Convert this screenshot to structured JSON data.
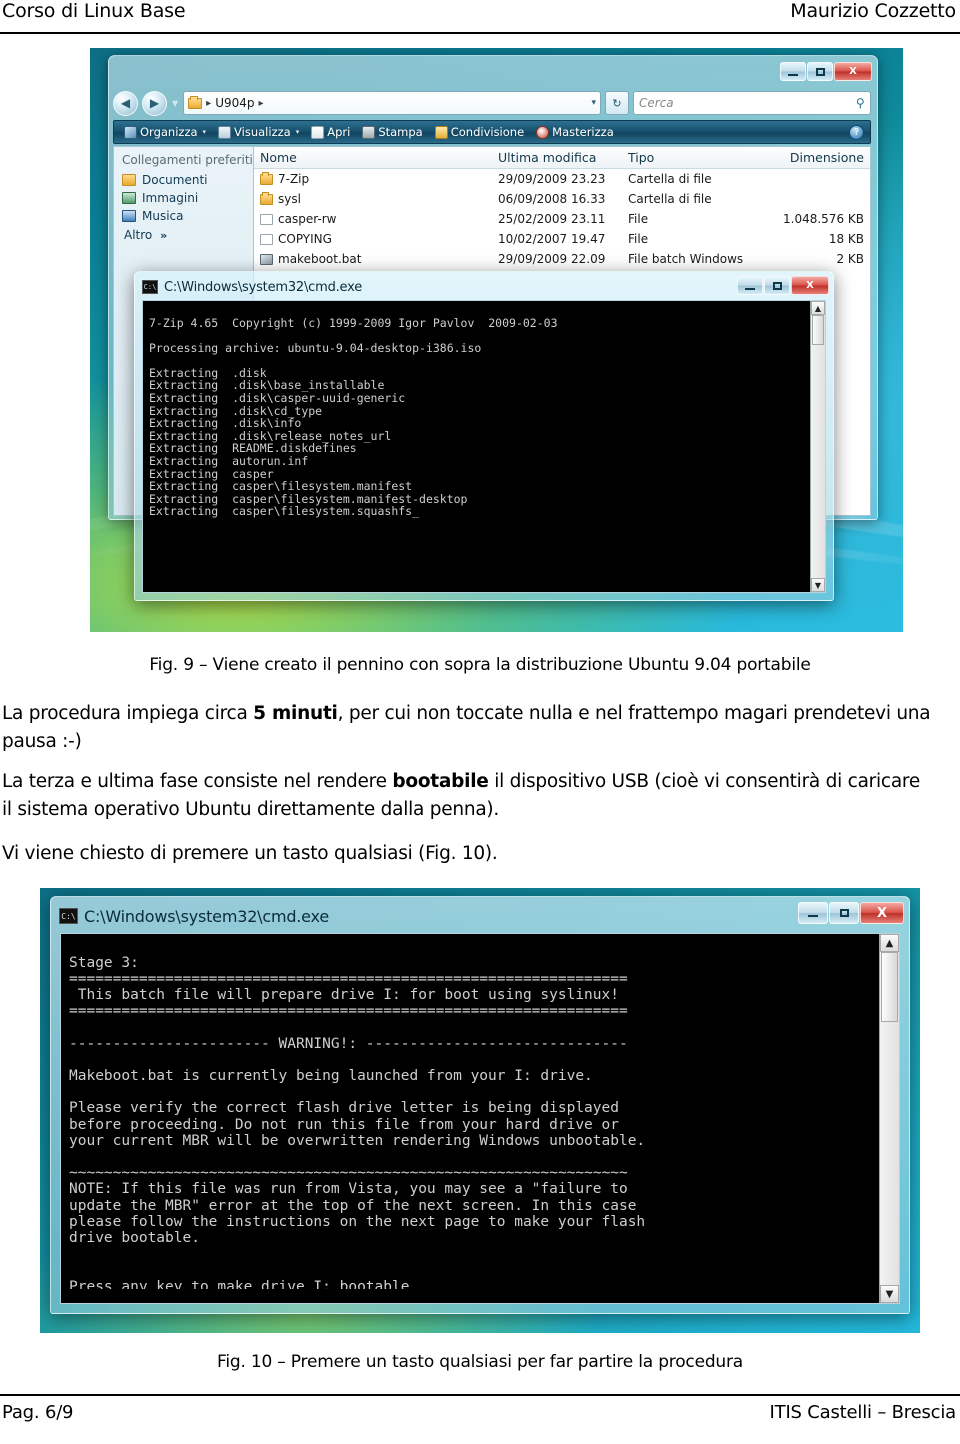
{
  "page": {
    "header_left": "Corso di Linux Base",
    "header_right": "Maurizio Cozzetto",
    "footer_left": "Pag. 6/9",
    "footer_right": "ITIS Castelli – Brescia"
  },
  "fig9": {
    "caption": "Fig. 9 – Viene creato il pennino con sopra la distribuzione Ubuntu 9.04 portabile"
  },
  "fig10": {
    "caption": "Fig. 10 – Premere un tasto qualsiasi per far partire la procedura"
  },
  "paragraphs": {
    "p1_a": "La procedura impiega circa ",
    "p1_b": "5 minuti",
    "p1_c": ", per cui non toccate nulla e nel frattempo magari prendetevi una pausa :-)",
    "p2_a": "La terza e ultima fase consiste nel rendere ",
    "p2_b": "bootabile",
    "p2_c": " il dispositivo USB (cioè vi consentirà di caricare il sistema operativo Ubuntu direttamente dalla penna).",
    "p3": "Vi viene chiesto di premere un tasto qualsiasi (Fig. 10)."
  },
  "explorer": {
    "window_buttons": {
      "minimize": "–",
      "maximize": "□",
      "close": "X"
    },
    "address": {
      "folder_name": "U904p",
      "sep": "▸",
      "dropdown_caret": "▾"
    },
    "refresh_label": "↻",
    "search": {
      "placeholder": "Cerca",
      "icon": "⚲"
    },
    "commandbar": {
      "organize": "Organizza",
      "view": "Visualizza",
      "open": "Apri",
      "print": "Stampa",
      "share": "Condivisione",
      "burn": "Masterizza",
      "caret": "▾",
      "help": "?"
    },
    "sidebar": {
      "heading": "Collegamenti preferiti",
      "items": [
        {
          "label": "Documenti"
        },
        {
          "label": "Immagini"
        },
        {
          "label": "Musica"
        }
      ],
      "more": "Altro",
      "more_chevron": "»"
    },
    "columns": {
      "name": "Nome",
      "modified": "Ultima modifica",
      "type": "Tipo",
      "size": "Dimensione"
    },
    "rows": [
      {
        "name": "7-Zip",
        "modified": "29/09/2009 23.23",
        "type": "Cartella di file",
        "size": "",
        "icon": "folder"
      },
      {
        "name": "sysl",
        "modified": "06/09/2008 16.33",
        "type": "Cartella di file",
        "size": "",
        "icon": "folder"
      },
      {
        "name": "casper-rw",
        "modified": "25/02/2009 23.11",
        "type": "File",
        "size": "1.048.576 KB",
        "icon": "file"
      },
      {
        "name": "COPYING",
        "modified": "10/02/2007 19.47",
        "type": "File",
        "size": "18 KB",
        "icon": "file"
      },
      {
        "name": "makeboot.bat",
        "modified": "29/09/2009 22.09",
        "type": "File batch Windows",
        "size": "2 KB",
        "icon": "bat"
      }
    ]
  },
  "console1": {
    "title": "C:\\Windows\\system32\\cmd.exe",
    "icon_label": "C:\\",
    "window_buttons": {
      "minimize": "–",
      "maximize": "□",
      "close": "X"
    },
    "scroll_up": "▲",
    "scroll_down": "▼",
    "text": "7-Zip 4.65  Copyright (c) 1999-2009 Igor Pavlov  2009-02-03\n\nProcessing archive: ubuntu-9.04-desktop-i386.iso\n\nExtracting  .disk\nExtracting  .disk\\base_installable\nExtracting  .disk\\casper-uuid-generic\nExtracting  .disk\\cd_type\nExtracting  .disk\\info\nExtracting  .disk\\release_notes_url\nExtracting  README.diskdefines\nExtracting  autorun.inf\nExtracting  casper\nExtracting  casper\\filesystem.manifest\nExtracting  casper\\filesystem.manifest-desktop\nExtracting  casper\\filesystem.squashfs_"
  },
  "console2": {
    "title": "C:\\Windows\\system32\\cmd.exe",
    "icon_label": "C:\\",
    "window_buttons": {
      "minimize": "–",
      "maximize": "□",
      "close": "X"
    },
    "scroll_up": "▲",
    "scroll_down": "▼",
    "text": "Stage 3:\n================================================================\n This batch file will prepare drive I: for boot using syslinux!\n================================================================\n\n----------------------- WARNING!: ------------------------------\n\nMakeboot.bat is currently being launched from your I: drive.\n\nPlease verify the correct flash drive letter is being displayed\nbefore proceeding. Do not run this file from your hard drive or\nyour current MBR will be overwritten rendering Windows unbootable.\n\n~~~~~~~~~~~~~~~~~~~~~~~~~~~~~~~~~~~~~~~~~~~~~~~~~~~~~~~~~~~~~~~~\nNOTE: If this file was run from Vista, you may see a \"failure to\nupdate the MBR\" error at the top of the next screen. In this case\nplease follow the instructions on the next page to make your flash\ndrive bootable.\n\n\nPress any key to make drive I: bootable\nor close this window to abort...\n\n_"
  }
}
